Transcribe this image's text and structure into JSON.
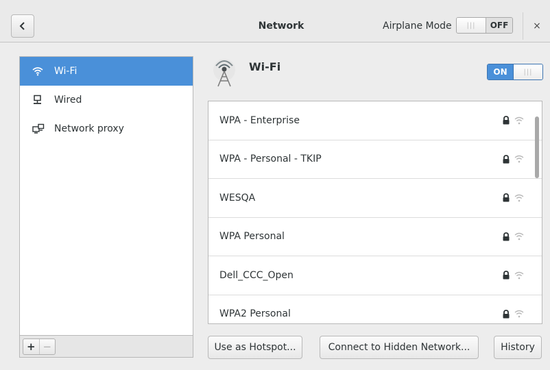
{
  "header": {
    "title": "Network",
    "airplane_mode_label": "Airplane Mode",
    "airplane_mode_state": "OFF",
    "close_symbol": "×"
  },
  "sidebar": {
    "items": [
      {
        "label": "Wi-Fi",
        "icon": "wifi-icon",
        "selected": true
      },
      {
        "label": "Wired",
        "icon": "wired-icon",
        "selected": false
      },
      {
        "label": "Network proxy",
        "icon": "network-proxy-icon",
        "selected": false
      }
    ],
    "add_symbol": "+",
    "remove_symbol": "−"
  },
  "wifi": {
    "title": "Wi-Fi",
    "switch_state": "ON",
    "networks": [
      {
        "name": "WPA - Enterprise",
        "secured": true
      },
      {
        "name": "WPA - Personal - TKIP",
        "secured": true
      },
      {
        "name": "WESQA",
        "secured": true
      },
      {
        "name": "WPA Personal",
        "secured": true
      },
      {
        "name": "Dell_CCC_Open",
        "secured": true
      },
      {
        "name": "WPA2 Personal",
        "secured": true
      }
    ],
    "buttons": {
      "hotspot": "Use as Hotspot...",
      "hidden_network": "Connect to Hidden Network...",
      "history": "History"
    }
  },
  "colors": {
    "accent": "#4a90d9",
    "header_bg": "#eaeaea",
    "panel_bg": "#ededed"
  }
}
